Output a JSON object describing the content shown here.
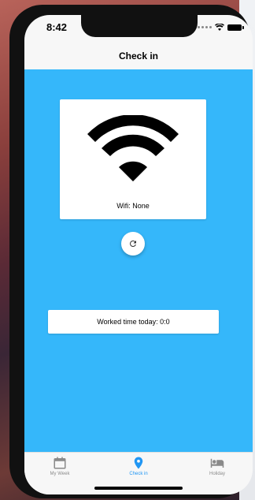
{
  "status_bar": {
    "time": "8:42"
  },
  "nav": {
    "title": "Check in"
  },
  "wifi_card": {
    "label": "Wifi: None"
  },
  "worked_time": {
    "text": "Worked time today: 0:0"
  },
  "tabs": [
    {
      "label": "My Week",
      "icon": "calendar-icon",
      "active": false
    },
    {
      "label": "Check in",
      "icon": "location-pin-icon",
      "active": true
    },
    {
      "label": "Holiday",
      "icon": "bed-icon",
      "active": false
    }
  ],
  "colors": {
    "main_background": "#35b7fa",
    "active_tab": "#2196f3",
    "inactive_tab": "#8a8a8a"
  }
}
